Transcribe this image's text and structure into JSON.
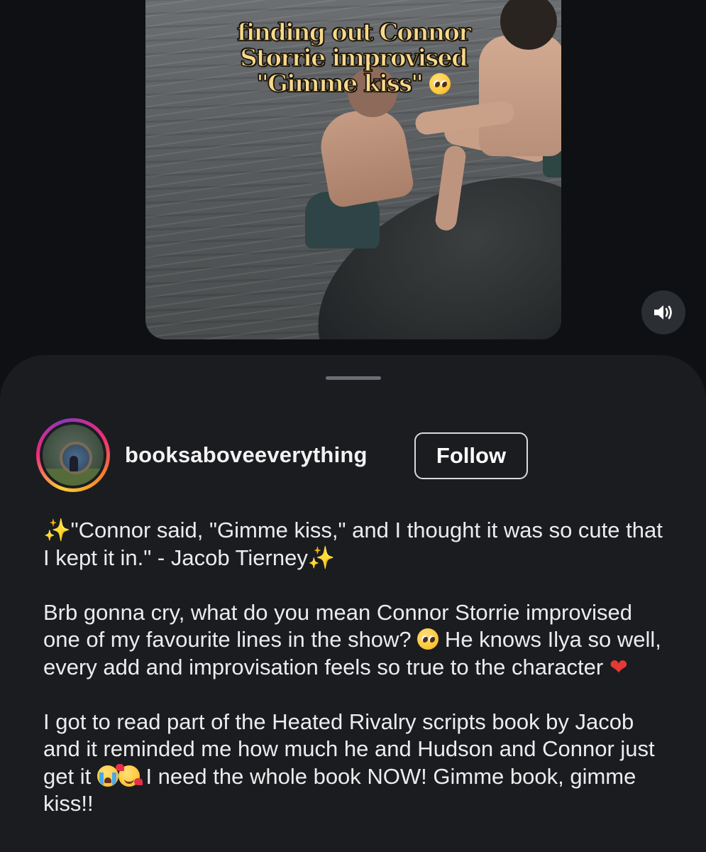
{
  "video": {
    "caption_lines": [
      "finding out Connor",
      "Storrie improvised",
      "\"Gimme kiss\""
    ],
    "caption_emoji": "pleading-face",
    "sound_icon": "speaker-volume-icon"
  },
  "profile": {
    "username": "booksaboveeverything",
    "follow_label": "Follow",
    "avatar_icon": "hobbit-door-photo"
  },
  "post": {
    "quote": "\"Connor said, \"Gimme kiss,\" and I thought it was so cute that I kept it in.\" - Jacob Tierney",
    "para2_a": "Brb gonna cry, what do you mean Connor Storrie improvised one of my favourite lines in the show?",
    "para2_b": " He knows Ilya so well, every add and improvisation feels so true to the character",
    "para3_a": "I got to read part of the Heated Rivalry scripts book by Jacob and it reminded me how much he and Hudson and Connor just get it",
    "para3_b": " I need the whole book NOW! Gimme book, gimme kiss!!"
  },
  "colors": {
    "background": "#0e1014",
    "sheet": "#1b1c20",
    "text": "#ececec",
    "caption": "#f7d98a"
  }
}
